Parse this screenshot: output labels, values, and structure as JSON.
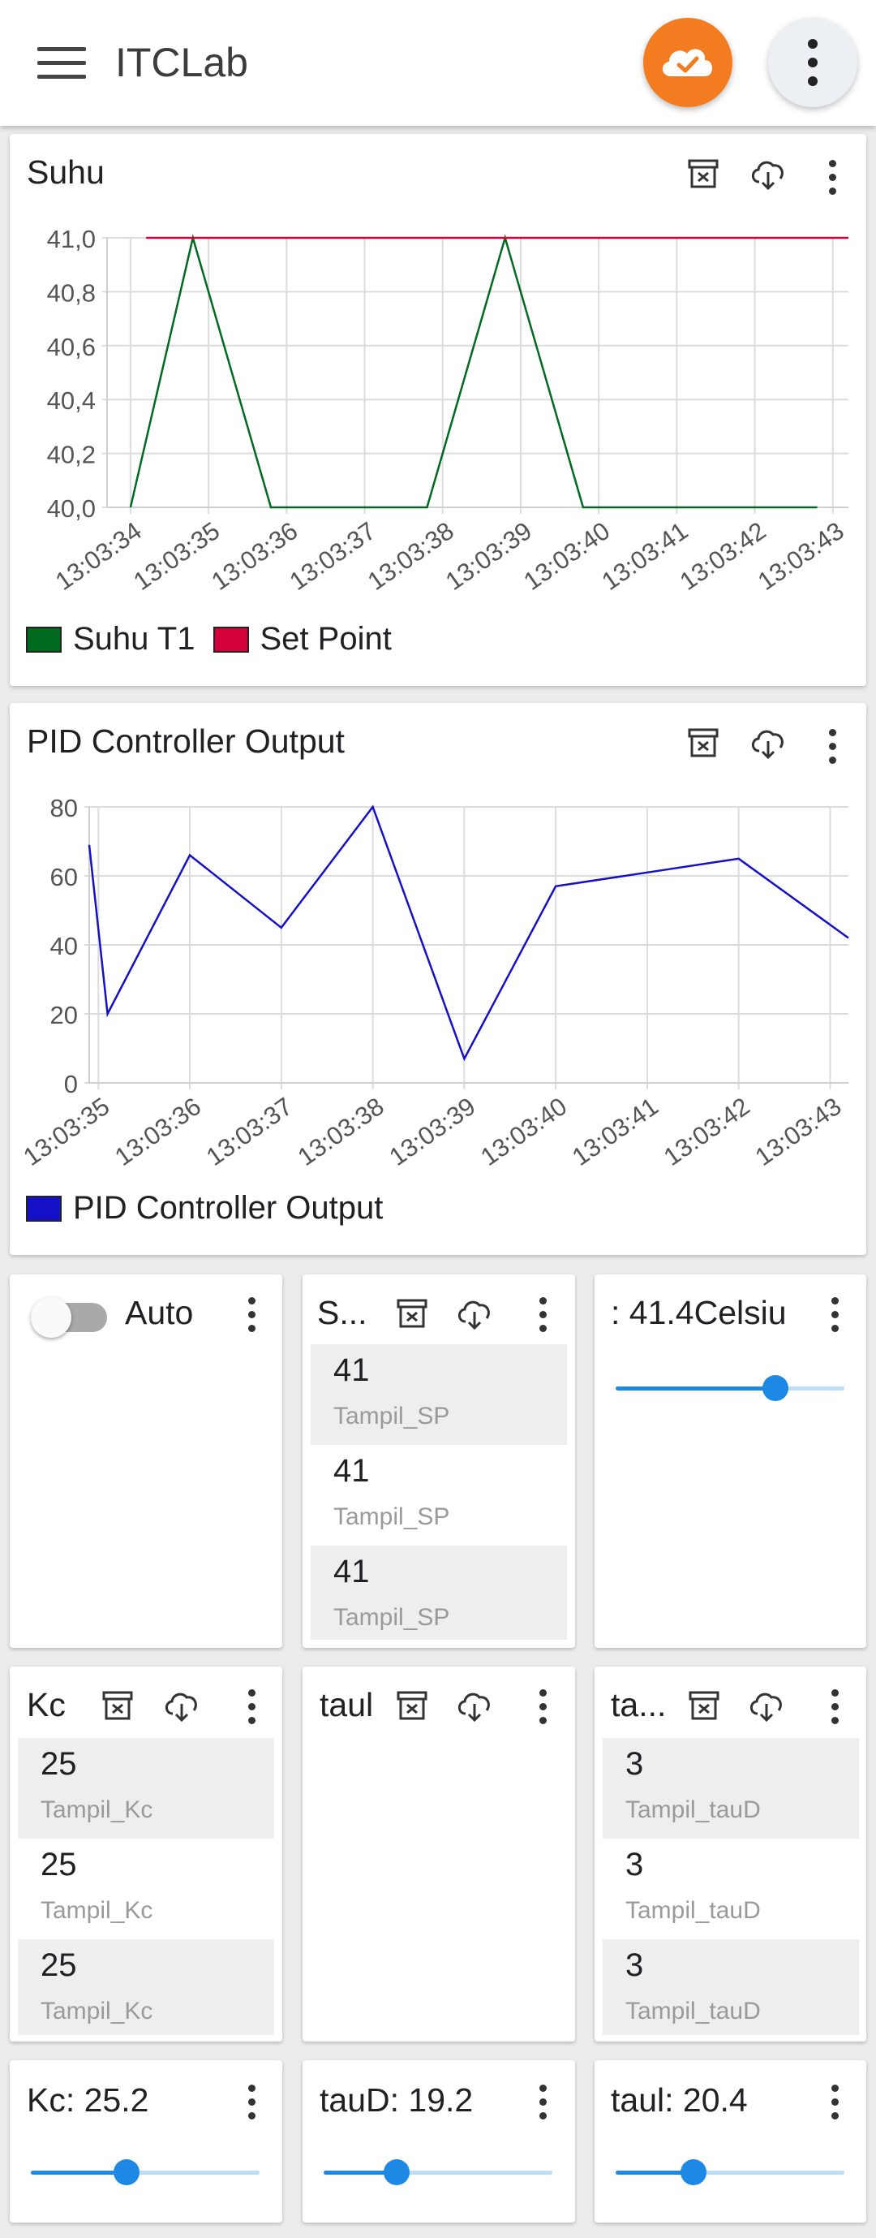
{
  "app": {
    "title": "ITCLab"
  },
  "colors": {
    "accent": "#f47c20",
    "slider": "#1e88e5",
    "series_green": "#006a1f",
    "series_red": "#d4003a",
    "series_blue": "#1410c8"
  },
  "icons": {
    "menu": "hamburger-menu-icon",
    "cloud": "cloud-check-icon",
    "more": "more-vertical-icon",
    "clear": "archive-x-icon",
    "download": "cloud-download-icon"
  },
  "cards": {
    "suhu": {
      "title": "Suhu"
    },
    "pid": {
      "title": "PID Controller Output"
    },
    "auto": {
      "label": "Auto",
      "checked": false
    },
    "sp_list": {
      "title": "S...",
      "items": [
        {
          "value": "41",
          "label": "Tampil_SP"
        },
        {
          "value": "41",
          "label": "Tampil_SP"
        },
        {
          "value": "41",
          "label": "Tampil_SP"
        }
      ]
    },
    "sp_slider": {
      "title": ": 41.4Celsiu",
      "level": 0.7
    },
    "kc_list": {
      "title": "Kc",
      "items": [
        {
          "value": "25",
          "label": "Tampil_Kc"
        },
        {
          "value": "25",
          "label": "Tampil_Kc"
        },
        {
          "value": "25",
          "label": "Tampil_Kc"
        }
      ]
    },
    "taui_list": {
      "title": "taul",
      "items": []
    },
    "taud_list": {
      "title": "ta...",
      "items": [
        {
          "value": "3",
          "label": "Tampil_tauD"
        },
        {
          "value": "3",
          "label": "Tampil_tauD"
        },
        {
          "value": "3",
          "label": "Tampil_tauD"
        }
      ]
    },
    "kc_slider": {
      "title": "Kc: 25.2",
      "level": 0.42
    },
    "taud_slider": {
      "title": "tauD: 19.2",
      "level": 0.32
    },
    "taui_slider": {
      "title": "taul: 20.4",
      "level": 0.34
    }
  },
  "chart_data": [
    {
      "type": "line",
      "title": "Suhu",
      "x": [
        "13:03:34",
        "13:03:35",
        "13:03:36",
        "13:03:37",
        "13:03:38",
        "13:03:39",
        "13:03:40",
        "13:03:41",
        "13:03:42",
        "13:03:43"
      ],
      "y_ticks": [
        "40,0",
        "40,2",
        "40,4",
        "40,6",
        "40,8",
        "41,0"
      ],
      "ylim": [
        40.0,
        41.0
      ],
      "grid": true,
      "legend_position": "bottom-left",
      "series": [
        {
          "name": "Suhu T1",
          "color": "#006a1f",
          "points": [
            [
              "13:03:34",
              40.0
            ],
            [
              "13:03:34.8",
              41.0
            ],
            [
              "13:03:35.8",
              40.0
            ],
            [
              "13:03:36.9",
              40.0
            ],
            [
              "13:03:37.8",
              40.0
            ],
            [
              "13:03:38.8",
              41.0
            ],
            [
              "13:03:39.8",
              40.0
            ],
            [
              "13:03:42.8",
              40.0
            ]
          ]
        },
        {
          "name": "Set Point",
          "color": "#d4003a",
          "points": [
            [
              "13:03:34.2",
              41.0
            ],
            [
              "13:03:43.2",
              41.0
            ]
          ]
        }
      ]
    },
    {
      "type": "line",
      "title": "PID Controller Output",
      "x": [
        "13:03:35",
        "13:03:36",
        "13:03:37",
        "13:03:38",
        "13:03:39",
        "13:03:40",
        "13:03:41",
        "13:03:42",
        "13:03:43"
      ],
      "y_ticks": [
        "0",
        "20",
        "40",
        "60",
        "80"
      ],
      "ylim": [
        0,
        80
      ],
      "grid": true,
      "legend_position": "bottom-left",
      "series": [
        {
          "name": "PID Controller Output",
          "color": "#1410c8",
          "points": [
            [
              "13:03:34.9",
              69
            ],
            [
              "13:03:35.1",
              20
            ],
            [
              "13:03:36.0",
              66
            ],
            [
              "13:03:37.0",
              45
            ],
            [
              "13:03:38.0",
              80
            ],
            [
              "13:03:39.0",
              7
            ],
            [
              "13:03:40.0",
              57
            ],
            [
              "13:03:41.0",
              61
            ],
            [
              "13:03:42.0",
              65
            ],
            [
              "13:03:43.2",
              42
            ]
          ]
        }
      ]
    }
  ]
}
